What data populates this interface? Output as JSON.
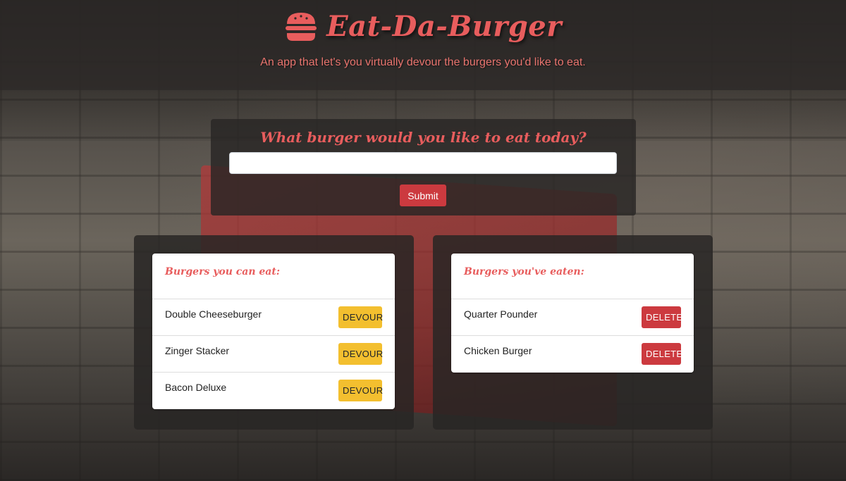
{
  "header": {
    "title": "Eat-Da-Burger",
    "tagline": "An app that let's you virtually devour the burgers you'd like to eat.",
    "icon": "hamburger-icon"
  },
  "form": {
    "heading": "What burger would you like to eat today?",
    "input_value": "",
    "input_placeholder": "",
    "submit_label": "Submit"
  },
  "uneaten": {
    "heading": "Burgers you can eat:",
    "button_label": "DEVOUR",
    "items": [
      {
        "name": "Double Cheeseburger"
      },
      {
        "name": "Zinger Stacker"
      },
      {
        "name": "Bacon Deluxe"
      }
    ]
  },
  "eaten": {
    "heading": "Burgers you've eaten:",
    "button_label": "DELETE",
    "items": [
      {
        "name": "Quarter Pounder"
      },
      {
        "name": "Chicken Burger"
      }
    ]
  },
  "colors": {
    "accent": "#e85d5d",
    "submit_bg": "#cc3a3f",
    "devour_bg": "#f3bf2f",
    "delete_bg": "#cc3a3f"
  }
}
